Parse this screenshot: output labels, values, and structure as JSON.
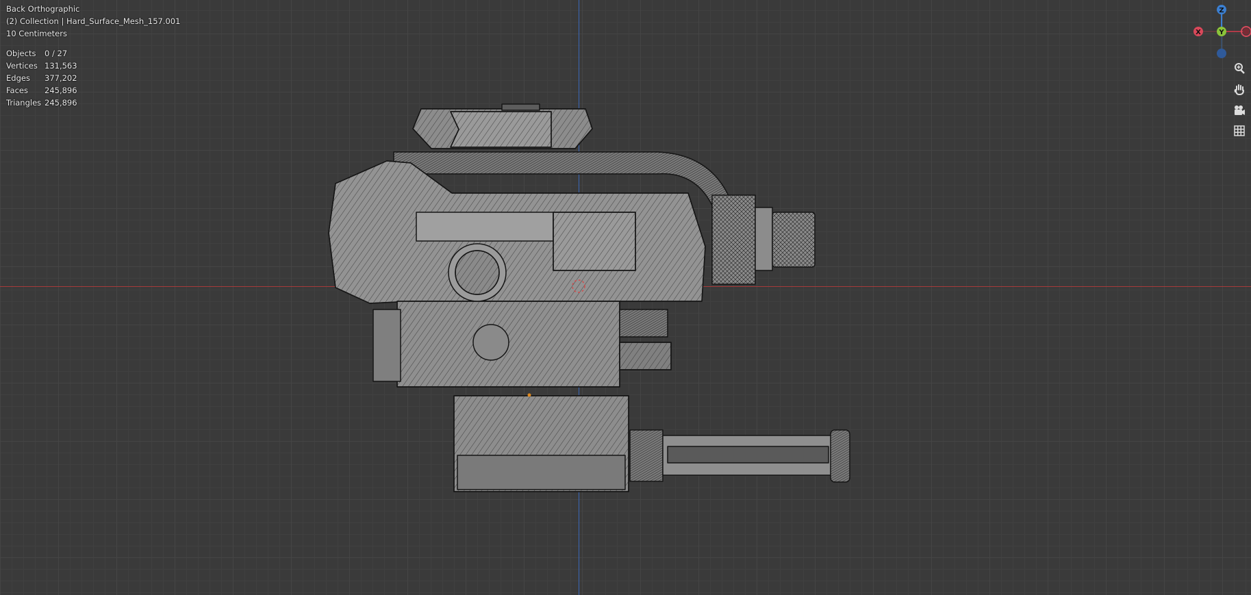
{
  "viewport": {
    "view_name": "Back Orthographic",
    "collection_line": "(2) Collection | Hard_Surface_Mesh_157.001",
    "scale": "10 Centimeters"
  },
  "stats": [
    {
      "label": "Objects",
      "value": "0 / 27"
    },
    {
      "label": "Vertices",
      "value": "131,563"
    },
    {
      "label": "Edges",
      "value": "377,202"
    },
    {
      "label": "Faces",
      "value": "245,896"
    },
    {
      "label": "Triangles",
      "value": "245,896"
    }
  ],
  "gizmo": {
    "z_label": "Z",
    "y_label": "Y",
    "x_label": "X",
    "colors": {
      "x": "#d9485a",
      "y": "#8ac43a",
      "z": "#3b7fd1"
    }
  },
  "tools": [
    "zoom-icon",
    "hand-pan-icon",
    "camera-icon",
    "grid-icon"
  ],
  "colors": {
    "background": "#3a3a3a",
    "grid": "#454545",
    "x_axis": "#a63a3a",
    "z_axis": "#3b67b8",
    "mesh_fill": "#8e8e8e",
    "wire": "#151515"
  }
}
